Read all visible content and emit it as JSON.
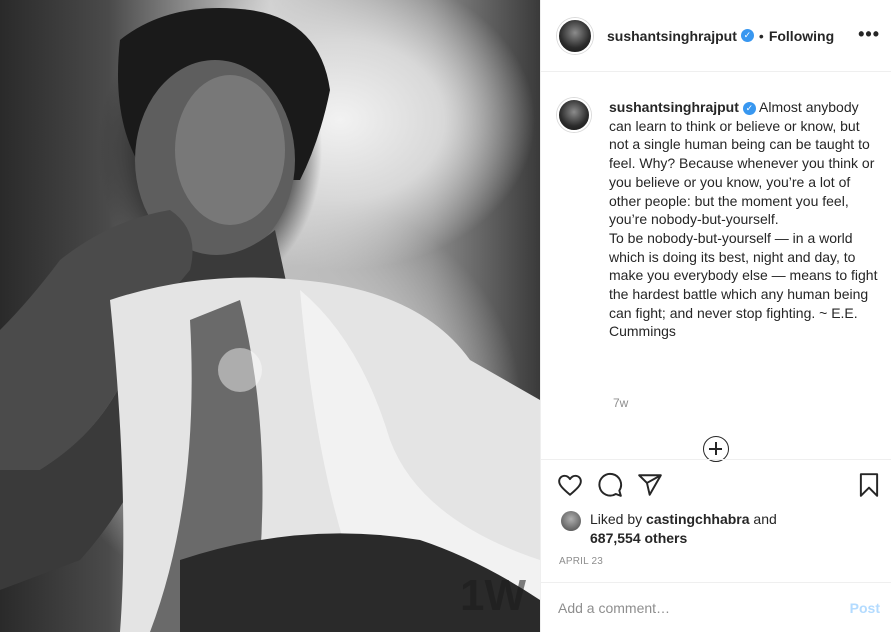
{
  "post": {
    "username": "sushantsinghrajput",
    "follow_status": "Following",
    "more_glyph": "•••",
    "separator": "•",
    "verified_glyph": "✓",
    "photo_watermark": "1W"
  },
  "caption": {
    "username": "sushantsinghrajput",
    "text": " Almost anybody can learn to think or believe or know, but not a single human being can be taught to feel. Why? Because whenever you think or you believe or you know, you’re a lot of other people: but the moment you feel, you’re nobody-but-yourself.\nTo be nobody-but-yourself — in a world which is doing its best, night and day, to make you everybody else — means to fight the hardest battle which any human being can fight; and never stop fighting. ~ E.E. Cummings",
    "time": "7w"
  },
  "engagement": {
    "liked_by_prefix": "Liked by ",
    "liked_by_user": "castingchhabra",
    "and": " and",
    "others_count": "687,554 others",
    "date": "APRIL 23"
  },
  "comment": {
    "placeholder": "Add a comment…",
    "post_label": "Post"
  },
  "icons": {
    "like": "heart-icon",
    "comment": "comment-icon",
    "share": "paper-plane-icon",
    "save": "bookmark-icon",
    "load_more": "plus-circle-icon",
    "verified": "verified-badge-icon",
    "more": "more-options-icon"
  },
  "colors": {
    "verified": "#3897f0",
    "post_disabled": "#b3dbff",
    "muted": "#8e8e8e",
    "text": "#262626"
  }
}
